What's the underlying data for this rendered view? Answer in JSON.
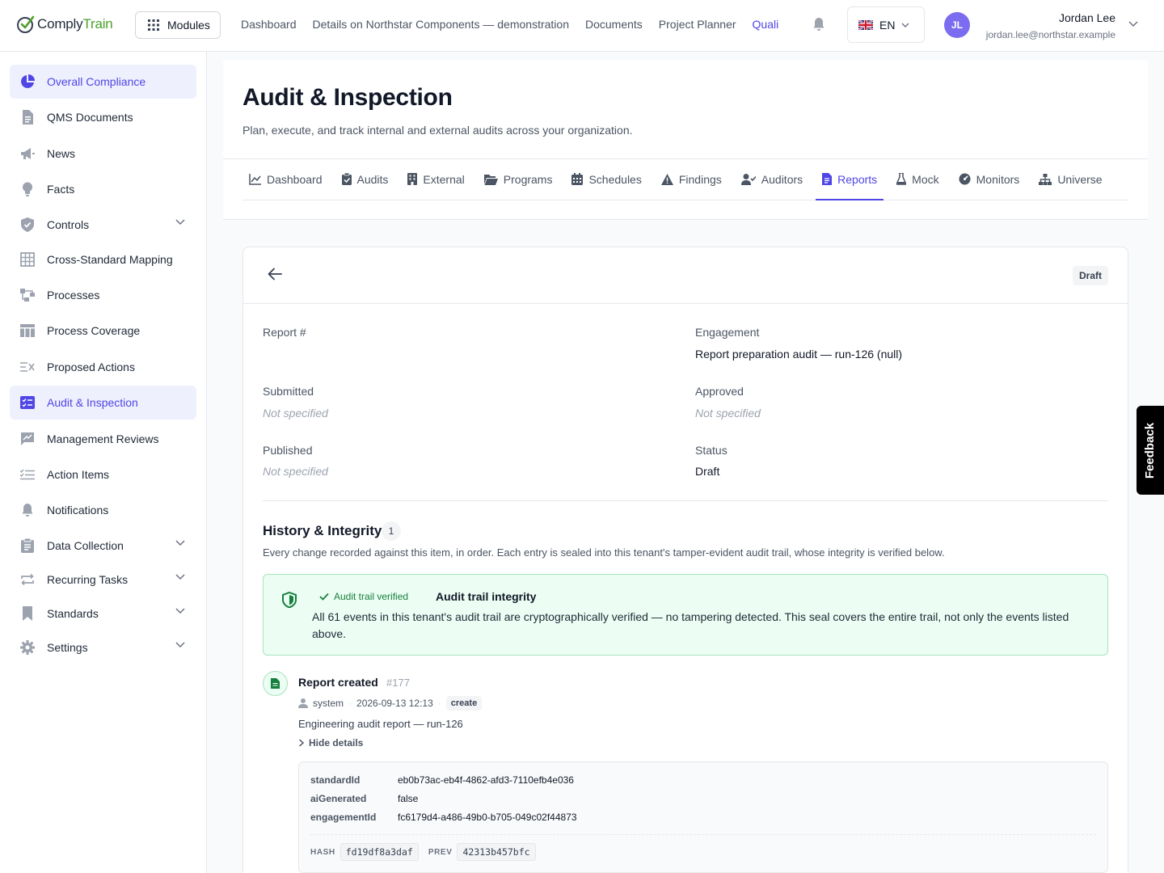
{
  "app": {
    "logo_part1": "Comply",
    "logo_part2": "Train",
    "modules_label": "Modules",
    "brand_color": "#4ca02a",
    "accent_color": "#4f46e5"
  },
  "topnav": {
    "items": [
      "Dashboard",
      "Details on Northstar Components — demonstration",
      "Documents",
      "Project Planner",
      "Quali"
    ],
    "active_index": 4,
    "language": "EN"
  },
  "user": {
    "initials": "JL",
    "name": "Jordan Lee",
    "email": "jordan.lee@northstar.example"
  },
  "sidebar": {
    "items": [
      {
        "label": "Overall Compliance",
        "icon": "pie-chart-icon",
        "active": true
      },
      {
        "label": "QMS Documents",
        "icon": "document-icon"
      },
      {
        "label": "News",
        "icon": "megaphone-icon"
      },
      {
        "label": "Facts",
        "icon": "lightbulb-icon"
      },
      {
        "label": "Controls",
        "icon": "shield-check-icon",
        "expandable": true
      },
      {
        "label": "Cross-Standard Mapping",
        "icon": "grid-icon"
      },
      {
        "label": "Processes",
        "icon": "flow-icon"
      },
      {
        "label": "Process Coverage",
        "icon": "table-icon"
      },
      {
        "label": "Proposed Actions",
        "icon": "list-x-icon"
      },
      {
        "label": "Audit & Inspection",
        "icon": "checklist-icon",
        "active": true
      },
      {
        "label": "Management Reviews",
        "icon": "chart-edit-icon"
      },
      {
        "label": "Action Items",
        "icon": "list-check-icon"
      },
      {
        "label": "Notifications",
        "icon": "bell-icon"
      },
      {
        "label": "Data Collection",
        "icon": "clipboard-icon",
        "expandable": true
      },
      {
        "label": "Recurring Tasks",
        "icon": "repeat-icon",
        "expandable": true
      },
      {
        "label": "Standards",
        "icon": "bookmark-icon",
        "expandable": true
      },
      {
        "label": "Settings",
        "icon": "gear-icon",
        "expandable": true
      }
    ]
  },
  "page": {
    "title": "Audit & Inspection",
    "subtitle": "Plan, execute, and track internal and external audits across your organization.",
    "tabs": [
      {
        "label": "Dashboard",
        "icon": "line-chart-icon"
      },
      {
        "label": "Audits",
        "icon": "clipboard-check-icon"
      },
      {
        "label": "External",
        "icon": "building-icon"
      },
      {
        "label": "Programs",
        "icon": "folder-open-icon"
      },
      {
        "label": "Schedules",
        "icon": "calendar-icon"
      },
      {
        "label": "Findings",
        "icon": "warning-icon"
      },
      {
        "label": "Auditors",
        "icon": "user-check-icon"
      },
      {
        "label": "Reports",
        "icon": "file-text-icon",
        "active": true
      },
      {
        "label": "Mock",
        "icon": "flask-icon"
      },
      {
        "label": "Monitors",
        "icon": "gauge-icon"
      },
      {
        "label": "Universe",
        "icon": "hierarchy-icon"
      }
    ]
  },
  "report": {
    "status_badge": "Draft",
    "fields": {
      "report_no_label": "Report #",
      "report_no_value": "",
      "engagement_label": "Engagement",
      "engagement_value": "Report preparation audit — run-126 (null)",
      "submitted_label": "Submitted",
      "submitted_value": "Not specified",
      "approved_label": "Approved",
      "approved_value": "Not specified",
      "published_label": "Published",
      "published_value": "Not specified",
      "status_label": "Status",
      "status_value": "Draft"
    }
  },
  "history": {
    "title": "History & Integrity",
    "count": "1",
    "description": "Every change recorded against this item, in order. Each entry is sealed into this tenant's tamper-evident audit trail, whose integrity is verified below.",
    "verify": {
      "badge": "Audit trail verified",
      "title": "Audit trail integrity",
      "text": "All 61 events in this tenant's audit trail are cryptographically verified — no tampering detected. This seal covers the entire trail, not only the events listed above."
    },
    "event": {
      "title": "Report created",
      "number": "#177",
      "actor": "system",
      "timestamp": "2026-09-13 12:13",
      "tag": "create",
      "description": "Engineering audit report — run-126",
      "toggle_label": "Hide details",
      "details": [
        {
          "key": "standardId",
          "value": "eb0b73ac-eb4f-4862-afd3-7110efb4e036"
        },
        {
          "key": "aiGenerated",
          "value": "false"
        },
        {
          "key": "engagementId",
          "value": "fc6179d4-a486-49b0-b705-049c02f44873"
        }
      ],
      "hash_label": "HASH",
      "hash_value": "fd19df8a3daf",
      "prev_label": "PREV",
      "prev_value": "42313b457bfc"
    }
  },
  "feedback_label": "Feedback"
}
